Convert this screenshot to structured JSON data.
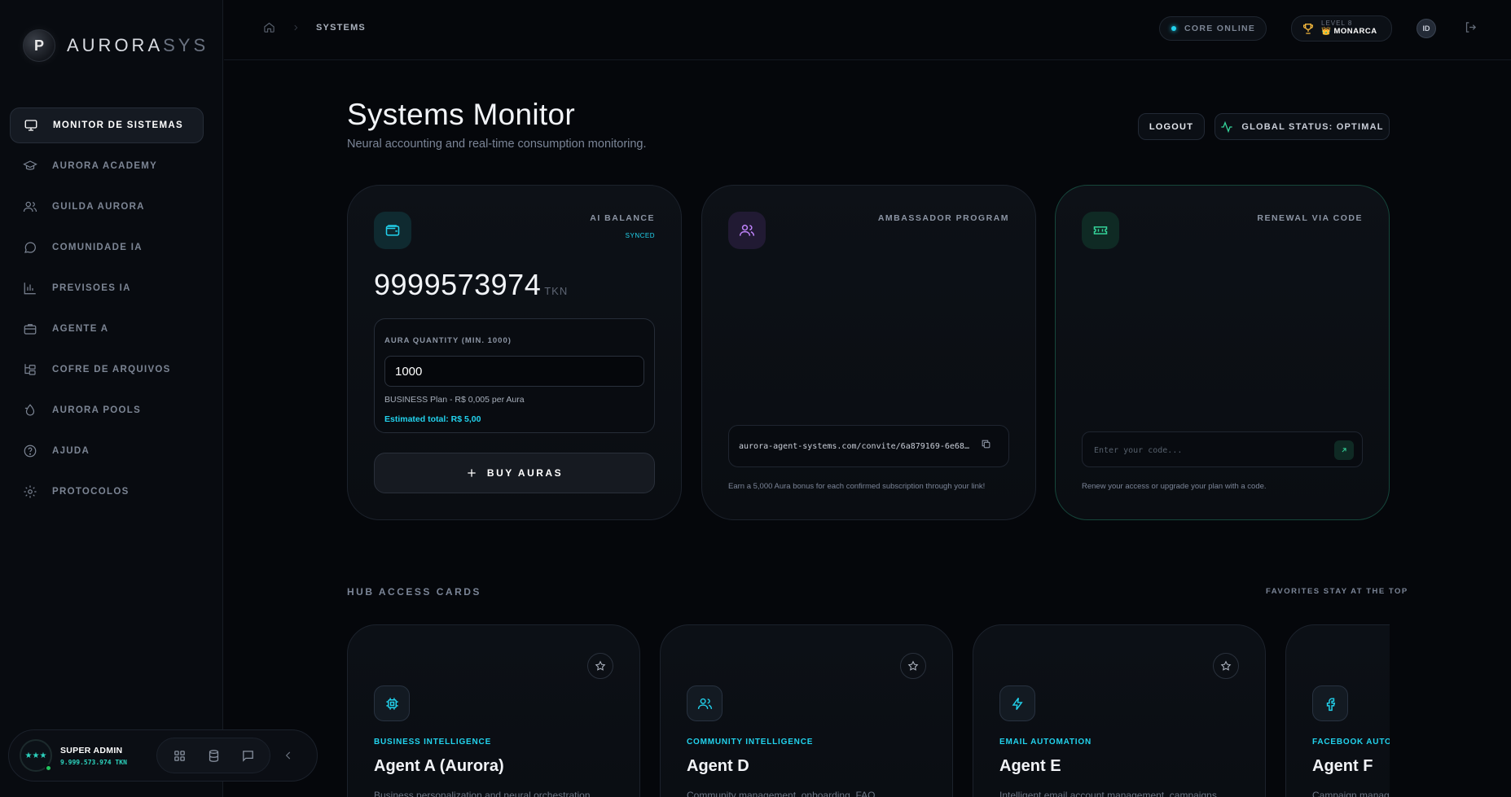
{
  "brand": {
    "name_main": "AURORA",
    "name_accent": "SYS",
    "logo_letter": "P"
  },
  "sidebar": {
    "items": [
      {
        "label": "MONITOR DE SISTEMAS",
        "icon": "monitor-icon"
      },
      {
        "label": "AURORA ACADEMY",
        "icon": "graduation-cap-icon"
      },
      {
        "label": "GUILDA AURORA",
        "icon": "users-icon"
      },
      {
        "label": "COMUNIDADE IA",
        "icon": "chat-bubble-icon"
      },
      {
        "label": "PREVISOES IA",
        "icon": "bar-chart-icon"
      },
      {
        "label": "AGENTE A",
        "icon": "briefcase-icon"
      },
      {
        "label": "COFRE DE ARQUIVOS",
        "icon": "folder-tree-icon"
      },
      {
        "label": "AURORA POOLS",
        "icon": "droplet-icon"
      },
      {
        "label": "AJUDA",
        "icon": "help-circle-icon"
      },
      {
        "label": "PROTOCOLOS",
        "icon": "gear-icon"
      }
    ],
    "user": {
      "name": "SUPER ADMIN",
      "tokens": "9.999.573.974 TKN",
      "avatar_text": "★★★"
    }
  },
  "topbar": {
    "breadcrumb_current": "SYSTEMS",
    "core_status": "CORE ONLINE",
    "level_label": "LEVEL 8",
    "level_rank": "👑 MONARCA",
    "user_initials": "ID"
  },
  "header": {
    "title": "Systems Monitor",
    "subtitle": "Neural accounting and real-time consumption monitoring.",
    "logout_label": "LOGOUT",
    "status_label": "GLOBAL STATUS: OPTIMAL"
  },
  "balance_card": {
    "label": "AI BALANCE",
    "sync_status": "SYNCED",
    "balance": "9999573974",
    "unit": "TKN",
    "qty_label": "AURA QUANTITY (MIN. 1000)",
    "qty_value": "1000",
    "plan_line": "BUSINESS Plan - R$ 0,005 per Aura",
    "estimate_line": "Estimated total: R$ 5,00",
    "buy_label": "BUY AURAS"
  },
  "ambassador_card": {
    "label": "AMBASSADOR PROGRAM",
    "invite_link": "aurora-agent-systems.com/convite/6a879169-6e68-40a…",
    "note": "Earn a 5,000 Aura bonus for each confirmed subscription through your link!"
  },
  "renewal_card": {
    "label": "RENEWAL VIA CODE",
    "code_placeholder": "Enter your code...",
    "note": "Renew your access or upgrade your plan with a code."
  },
  "hub": {
    "section_label": "HUB ACCESS CARDS",
    "section_hint": "FAVORITES STAY AT THE TOP",
    "cards": [
      {
        "category": "BUSINESS INTELLIGENCE",
        "title": "Agent A (Aurora)",
        "desc": "Business personalization and neural orchestration",
        "icon": "chip-icon"
      },
      {
        "category": "COMMUNITY INTELLIGENCE",
        "title": "Agent D",
        "desc": "Community management, onboarding, FAQ",
        "icon": "users-icon"
      },
      {
        "category": "EMAIL AUTOMATION",
        "title": "Agent E",
        "desc": "Intelligent email account management, campaigns",
        "icon": "lightning-icon"
      },
      {
        "category": "FACEBOOK AUTOMATION",
        "title": "Agent F",
        "desc": "Campaign management",
        "icon": "facebook-icon"
      }
    ]
  }
}
